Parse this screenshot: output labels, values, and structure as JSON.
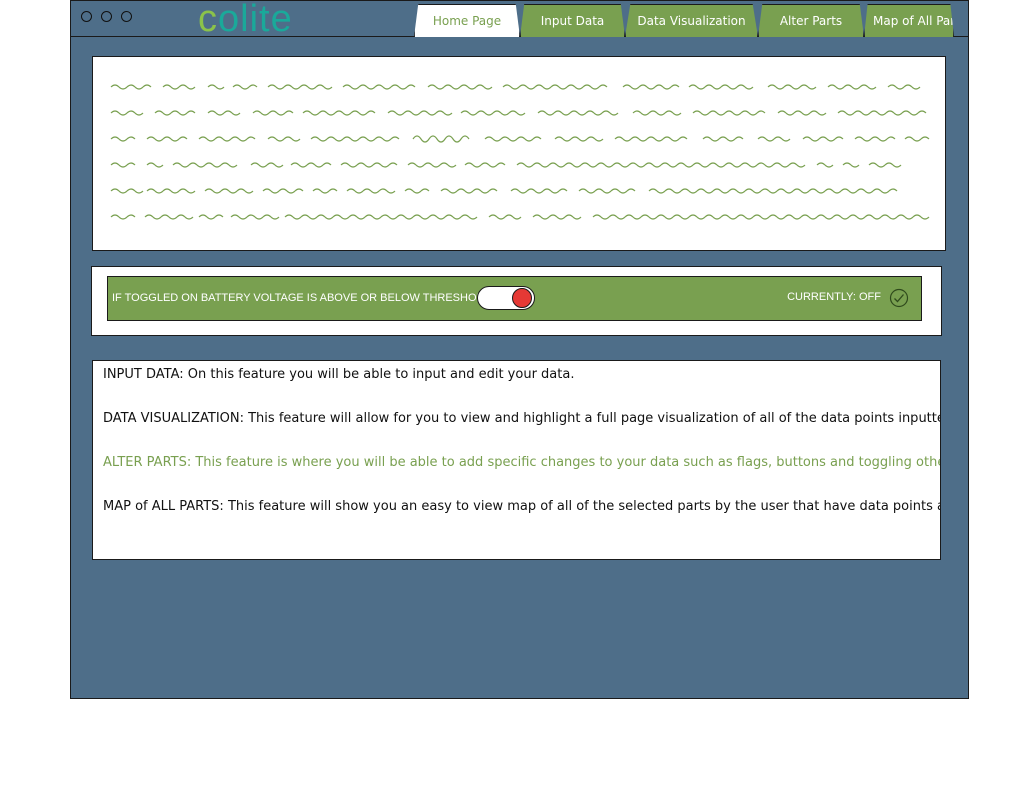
{
  "app": {
    "logo_text": "colite",
    "logo_prefix": "c",
    "logo_suffix": "olite"
  },
  "tabs": [
    {
      "label": "Home Page",
      "active": true
    },
    {
      "label": "Input Data",
      "active": false
    },
    {
      "label": "Data Visualization",
      "active": false
    },
    {
      "label": "Alter Parts",
      "active": false
    },
    {
      "label": "Map of All Parts",
      "active": false
    }
  ],
  "toggle_panel": {
    "label": "IF TOGGLED ON BATTERY VOLTAGE IS ABOVE OR BELOW THRESHOLD!!!",
    "status": "CURRENTLY: OFF",
    "toggle_on": false
  },
  "features": [
    {
      "text": "INPUT DATA: On this feature you will be able to input and edit your data.",
      "color": "#111111"
    },
    {
      "text": "DATA VISUALIZATION: This feature will allow for you to view and highlight a full page visualization of all of the data points inputted over a",
      "color": "#111111"
    },
    {
      "text": "ALTER PARTS: This feature is where you will be able to add specific changes to your data such as flags, buttons and toggling other aspe",
      "color": "#79a050"
    },
    {
      "text": "MAP of ALL PARTS: This feature will show you an easy to view map of all of the selected parts by the user that have data points assoc",
      "color": "#111111"
    }
  ],
  "colors": {
    "window_bg": "#4e6e89",
    "accent_green": "#79a050",
    "logo_teal": "#1aa99a",
    "toggle_knob": "#e53935"
  }
}
